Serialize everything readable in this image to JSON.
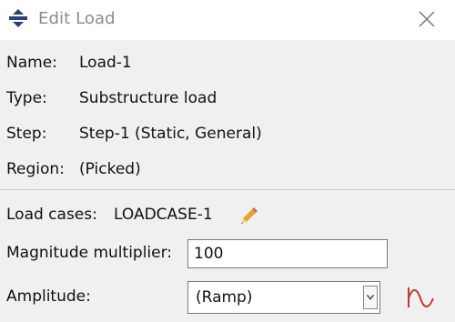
{
  "window": {
    "title": "Edit Load",
    "app_icon": "abaqus-logo-icon",
    "close_icon": "close-icon"
  },
  "info": {
    "name_label": "Name:",
    "name_value": "Load-1",
    "type_label": "Type:",
    "type_value": "Substructure load",
    "step_label": "Step:",
    "step_value": "Step-1 (Static, General)",
    "region_label": "Region:",
    "region_value": "(Picked)"
  },
  "load_cases": {
    "label": "Load cases:",
    "value": "LOADCASE-1",
    "edit_icon": "pencil-icon"
  },
  "magnitude": {
    "label": "Magnitude multiplier:",
    "value": "100"
  },
  "amplitude": {
    "label": "Amplitude:",
    "value": "(Ramp)",
    "dropdown_icon": "chevron-down-icon",
    "create_icon": "amplitude-wave-icon"
  },
  "colors": {
    "title_text": "#8c8c8c",
    "accent_wave": "#c0392b",
    "pencil": "#e0a030"
  }
}
